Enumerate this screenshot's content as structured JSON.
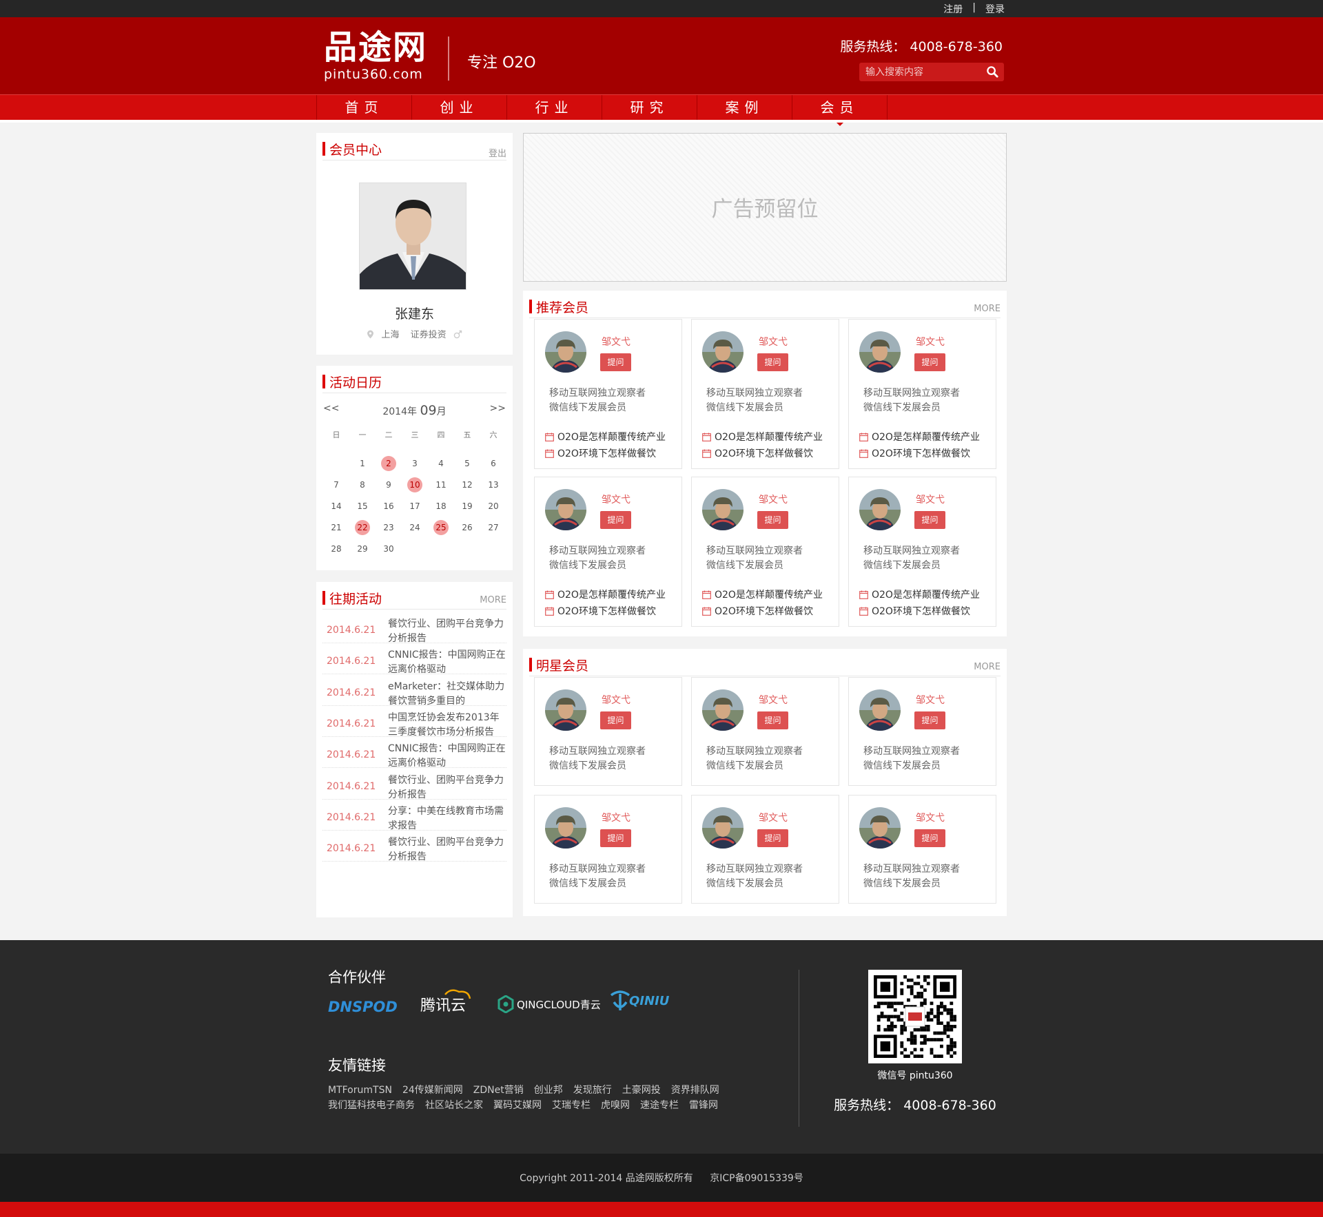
{
  "topbar": {
    "register": "注册",
    "separator": "|",
    "login": "登录"
  },
  "header": {
    "logo_cn": "品途网",
    "logo_en": "pintu360.com",
    "slogan": "专注 O2O",
    "hotline": "服务热线： 4008-678-360",
    "search_placeholder": "输入搜索内容"
  },
  "nav": {
    "items": [
      "首页",
      "创业",
      "行业",
      "研究",
      "案例",
      "会员"
    ],
    "active": "会员"
  },
  "member_center": {
    "title": "会员中心",
    "logout": "登出",
    "name": "张建东",
    "city": "上海",
    "industry": "证券投资",
    "gender_icon": "male-icon"
  },
  "calendar": {
    "title": "活动日历",
    "prev": "<<",
    "next": ">>",
    "year": "2014年",
    "month": "09",
    "month_suffix": "月",
    "weekdays": [
      "日",
      "一",
      "二",
      "三",
      "四",
      "五",
      "六"
    ],
    "weeks": [
      [
        "",
        "1",
        "2",
        "3",
        "4",
        "5",
        "6"
      ],
      [
        "7",
        "8",
        "9",
        "10",
        "11",
        "12",
        "13"
      ],
      [
        "14",
        "15",
        "16",
        "17",
        "18",
        "19",
        "20"
      ],
      [
        "21",
        "22",
        "23",
        "24",
        "25",
        "26",
        "27"
      ],
      [
        "28",
        "29",
        "30",
        "",
        "",
        "",
        ""
      ]
    ],
    "highlighted": [
      "2",
      "10",
      "22",
      "25"
    ]
  },
  "past_events": {
    "title": "往期活动",
    "more": "MORE",
    "items": [
      {
        "date": "2014.6.21",
        "text": "餐饮行业、团购平台竞争力分析报告"
      },
      {
        "date": "2014.6.21",
        "text": "CNNIC报告：中国网购正在远离价格驱动"
      },
      {
        "date": "2014.6.21",
        "text": "eMarketer：社交媒体助力餐饮营销多重目的"
      },
      {
        "date": "2014.6.21",
        "text": "中国烹饪协会发布2013年三季度餐饮市场分析报告"
      },
      {
        "date": "2014.6.21",
        "text": "CNNIC报告：中国网购正在远离价格驱动"
      },
      {
        "date": "2014.6.21",
        "text": "餐饮行业、团购平台竞争力分析报告"
      },
      {
        "date": "2014.6.21",
        "text": "分享：中美在线教育市场需求报告"
      },
      {
        "date": "2014.6.21",
        "text": "餐饮行业、团购平台竞争力分析报告"
      }
    ]
  },
  "ad": {
    "label": "广告预留位"
  },
  "recommended": {
    "title": "推荐会员",
    "more": "MORE",
    "members": [
      {
        "name": "邹文弋",
        "ask": "提问",
        "desc1": "移动互联网独立观察者",
        "desc2": "微信线下发展会员",
        "art1": "O2O是怎样颠覆传统产业",
        "art2": "O2O环境下怎样做餐饮"
      },
      {
        "name": "邹文弋",
        "ask": "提问",
        "desc1": "移动互联网独立观察者",
        "desc2": "微信线下发展会员",
        "art1": "O2O是怎样颠覆传统产业",
        "art2": "O2O环境下怎样做餐饮"
      },
      {
        "name": "邹文弋",
        "ask": "提问",
        "desc1": "移动互联网独立观察者",
        "desc2": "微信线下发展会员",
        "art1": "O2O是怎样颠覆传统产业",
        "art2": "O2O环境下怎样做餐饮"
      },
      {
        "name": "邹文弋",
        "ask": "提问",
        "desc1": "移动互联网独立观察者",
        "desc2": "微信线下发展会员",
        "art1": "O2O是怎样颠覆传统产业",
        "art2": "O2O环境下怎样做餐饮"
      },
      {
        "name": "邹文弋",
        "ask": "提问",
        "desc1": "移动互联网独立观察者",
        "desc2": "微信线下发展会员",
        "art1": "O2O是怎样颠覆传统产业",
        "art2": "O2O环境下怎样做餐饮"
      },
      {
        "name": "邹文弋",
        "ask": "提问",
        "desc1": "移动互联网独立观察者",
        "desc2": "微信线下发展会员",
        "art1": "O2O是怎样颠覆传统产业",
        "art2": "O2O环境下怎样做餐饮"
      }
    ]
  },
  "star": {
    "title": "明星会员",
    "more": "MORE",
    "members": [
      {
        "name": "邹文弋",
        "ask": "提问",
        "desc1": "移动互联网独立观察者",
        "desc2": "微信线下发展会员"
      },
      {
        "name": "邹文弋",
        "ask": "提问",
        "desc1": "移动互联网独立观察者",
        "desc2": "微信线下发展会员"
      },
      {
        "name": "邹文弋",
        "ask": "提问",
        "desc1": "移动互联网独立观察者",
        "desc2": "微信线下发展会员"
      },
      {
        "name": "邹文弋",
        "ask": "提问",
        "desc1": "移动互联网独立观察者",
        "desc2": "微信线下发展会员"
      },
      {
        "name": "邹文弋",
        "ask": "提问",
        "desc1": "移动互联网独立观察者",
        "desc2": "微信线下发展会员"
      },
      {
        "name": "邹文弋",
        "ask": "提问",
        "desc1": "移动互联网独立观察者",
        "desc2": "微信线下发展会员"
      }
    ]
  },
  "footer": {
    "partners_title": "合作伙伴",
    "partners": [
      "DNSPOD",
      "腾讯云",
      "QINGCLOUD青云",
      "QINIU"
    ],
    "links_title": "友情链接",
    "links_row1": [
      "MTForumTSN",
      "24传媒新闻网",
      "ZDNet营销",
      "创业邦",
      "发现旅行",
      "土豪网投",
      "资界排队网"
    ],
    "links_row2": [
      "我们猛科技电子商务",
      "社区站长之家",
      "翼码艾媒网",
      "艾瑞专栏",
      "虎嗅网",
      "速途专栏",
      "雷锋网"
    ],
    "wechat": "微信号 pintu360",
    "hotline": "服务热线： 4008-678-360",
    "copyright": "Copyright 2011-2014 品途网版权所有",
    "icp": "京ICP备09015339号"
  },
  "colors": {
    "brand_red": "#a30000",
    "nav_red": "#d30c0c",
    "accent": "#dd5151"
  }
}
